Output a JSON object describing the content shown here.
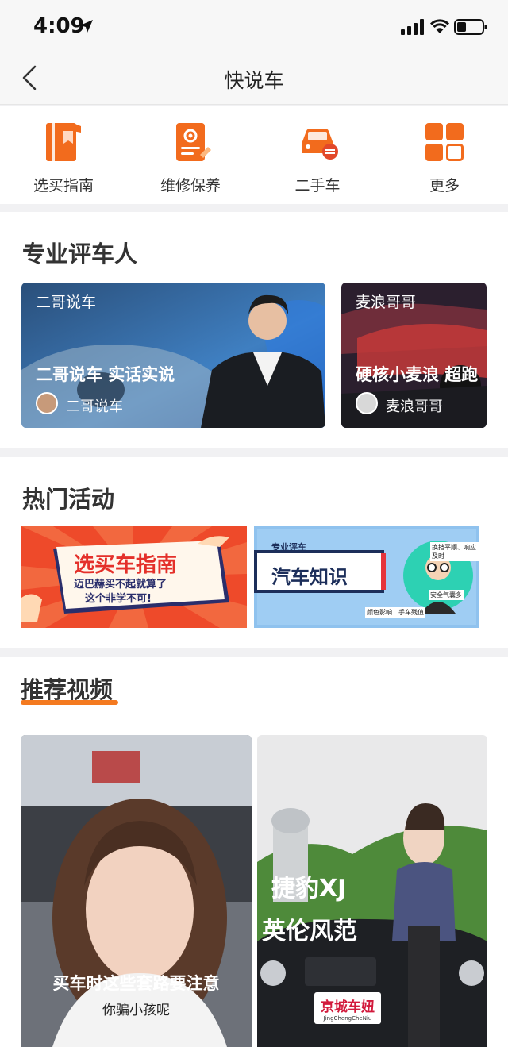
{
  "status": {
    "time": "4:09"
  },
  "nav": {
    "title": "快说车"
  },
  "quick_menu": [
    {
      "label": "选买指南",
      "icon": "guide-book-icon"
    },
    {
      "label": "维修保养",
      "icon": "maintenance-gear-icon"
    },
    {
      "label": "二手车",
      "icon": "used-car-icon"
    },
    {
      "label": "更多",
      "icon": "more-grid-icon"
    }
  ],
  "reviewers": {
    "title": "专业评车人",
    "cards": [
      {
        "name": "二哥说车",
        "tagline": "二哥说车 实话实说",
        "author": "二哥说车"
      },
      {
        "name": "麦浪哥哥",
        "tagline": "硬核小麦浪 超跑",
        "author": "麦浪哥哥"
      }
    ]
  },
  "activities": {
    "title": "热门活动",
    "banners": [
      {
        "headline": "选买车指南",
        "sub1": "迈巴赫买不起就算了",
        "sub2": "这个非学不可!"
      },
      {
        "tag": "专业评车",
        "headline": "汽车知识",
        "b1": "换挡平顺、响应及时",
        "b2": "安全气囊多",
        "b3": "颜色影响二手车残值"
      }
    ]
  },
  "videos": {
    "title": "推荐视频",
    "items": [
      {
        "caption": "买车时这些套路要注意",
        "subtitle": "你骗小孩呢"
      },
      {
        "overlay1": "捷豹XJ",
        "overlay2": "英伦风范",
        "plate": "京城车妞",
        "plate_sub": "JingChengCheNiu"
      }
    ]
  },
  "colors": {
    "accent": "#f47a20",
    "icon_orange": "#f26b1d"
  }
}
